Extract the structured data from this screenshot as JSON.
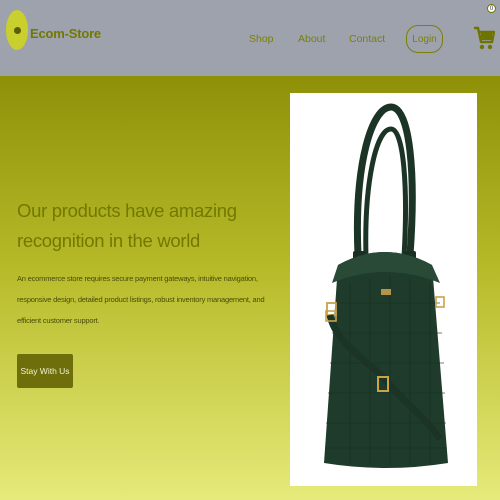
{
  "header": {
    "brand": "Ecom-Store",
    "nav": [
      "Shop",
      "About",
      "Contact"
    ],
    "login_label": "Login",
    "cart_count": "0"
  },
  "hero": {
    "headline_line1": "Our products have amazing",
    "headline_line2": "recognition in the world",
    "description": "An ecommerce store requires secure payment gateways, intuitive navigation, responsive design, detailed product listings, robust inventory management, and efficient customer support.",
    "cta_label": "Stay With Us",
    "product_image_icon": "handbag-image"
  },
  "colors": {
    "navbar": "#9ea2ad",
    "accent": "#737800",
    "button": "#6e6f0a",
    "bag": "#1f3b2b"
  }
}
